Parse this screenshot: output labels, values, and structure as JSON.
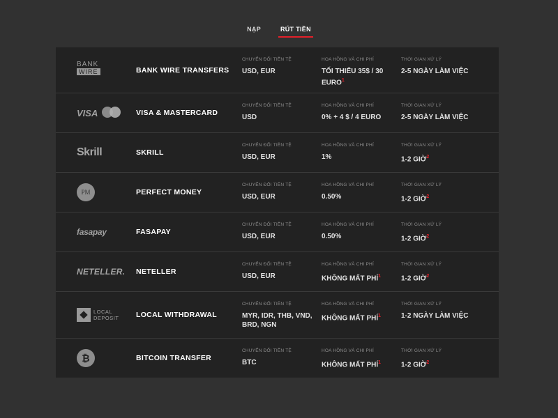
{
  "tabs": [
    {
      "label": "NẠP",
      "active": false
    },
    {
      "label": "RÚT TIỀN",
      "active": true
    }
  ],
  "labels": {
    "currency": "CHUYỂN ĐỔI TIỀN TỆ",
    "fees": "HOA HỒNG VÀ CHI PHÍ",
    "processing": "THỜI GIAN XỬ LÝ"
  },
  "methods": [
    {
      "name": "BANK WIRE TRANSFERS",
      "logo": {
        "line1": "BANK",
        "line2": "WIRE"
      },
      "currency": "USD, EUR",
      "fees": "TỐI THIỂU 35$ / 30 EURO",
      "processing": "2-5 NGÀY LÀM VIỆC"
    },
    {
      "name": "VISA & MASTERCARD",
      "logo": {
        "text": "VISA"
      },
      "currency": "USD",
      "fees": "0% + 4 $ / 4 EURO",
      "processing": "2-5 NGÀY LÀM VIỆC"
    },
    {
      "name": "SKRILL",
      "logo": {
        "text": "Skrill"
      },
      "currency": "USD, EUR",
      "fees": "1%",
      "processing": "1-2 GIỜ"
    },
    {
      "name": "PERFECT MONEY",
      "logo": {
        "text": "PM"
      },
      "currency": "USD, EUR",
      "fees": "0.50%",
      "processing": "1-2 GIỜ"
    },
    {
      "name": "FASAPAY",
      "logo": {
        "text": "fasapay"
      },
      "currency": "USD, EUR",
      "fees": "0.50%",
      "processing": "1-2 GIỜ"
    },
    {
      "name": "NETELLER",
      "logo": {
        "text": "NETELLER."
      },
      "currency": "USD, EUR",
      "fees": "KHÔNG MẤT PHÍ",
      "processing": "1-2 GIỜ"
    },
    {
      "name": "LOCAL WITHDRAWAL",
      "logo": {
        "line1": "LOCAL",
        "line2": "DEPOSIT"
      },
      "currency": "MYR, IDR, THB, VND, BRD, NGN",
      "fees": "KHÔNG MẤT PHÍ",
      "processing": "1-2 NGÀY LÀM VIỆC"
    },
    {
      "name": "BITCOIN TRANSFER",
      "logo": {
        "text": "₿"
      },
      "currency": "BTC",
      "fees": "KHÔNG MẤT PHÍ",
      "processing": "1-2 GIỜ"
    }
  ],
  "colors": {
    "accent": "#e5202a",
    "row_bg": "#222222",
    "page_bg": "#313131"
  }
}
